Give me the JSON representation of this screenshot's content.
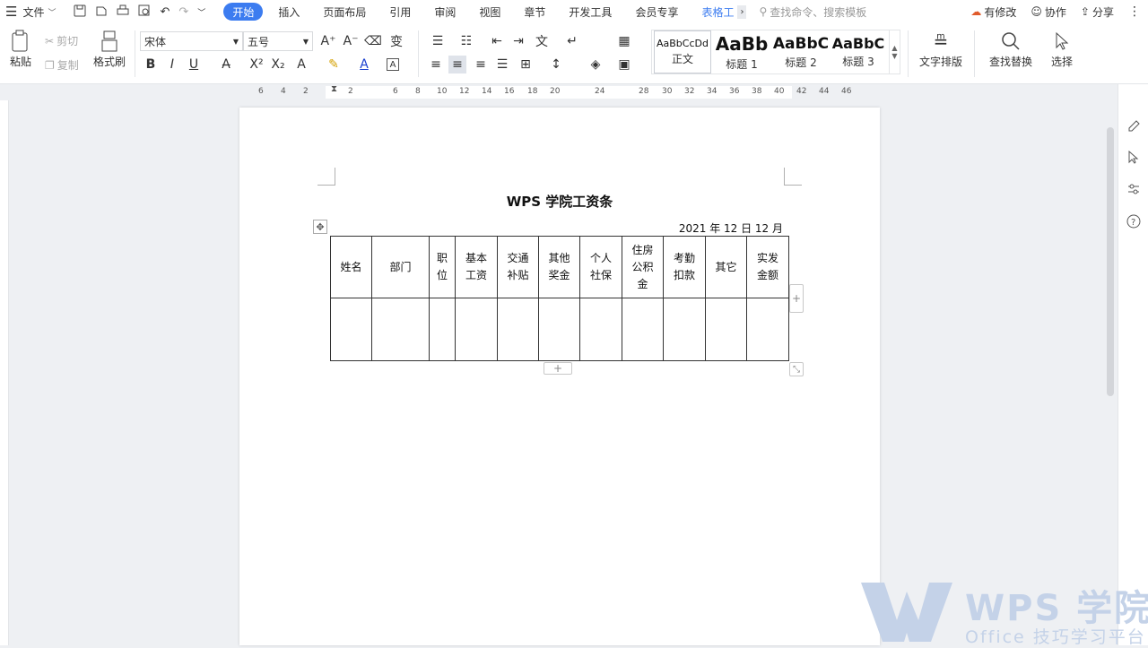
{
  "menubar": {
    "file_label": "文件",
    "tabs": [
      {
        "label": "开始",
        "active": true
      },
      {
        "label": "插入"
      },
      {
        "label": "页面布局"
      },
      {
        "label": "引用"
      },
      {
        "label": "审阅"
      },
      {
        "label": "视图"
      },
      {
        "label": "章节"
      },
      {
        "label": "开发工具"
      },
      {
        "label": "会员专享"
      },
      {
        "label": "表格工"
      }
    ],
    "search_placeholder": "查找命令、搜索模板",
    "actions": {
      "changes": "有修改",
      "collab": "协作",
      "share": "分享"
    }
  },
  "ribbon": {
    "paste": "粘贴",
    "cut": "剪切",
    "copy": "复制",
    "format_painter": "格式刷",
    "font_name": "宋体",
    "font_size": "五号",
    "styles": [
      {
        "sample": "AaBbCcDd",
        "name": "正文"
      },
      {
        "sample": "AaBb",
        "name": "标题 1"
      },
      {
        "sample": "AaBbC",
        "name": "标题 2"
      },
      {
        "sample": "AaBbC",
        "name": "标题 3"
      }
    ],
    "text_layout": "文字排版",
    "find_replace": "查找替换",
    "select": "选择"
  },
  "ruler": {
    "ticks": [
      "6",
      "4",
      "2",
      "2",
      "6",
      "8",
      "10",
      "12",
      "14",
      "16",
      "18",
      "20",
      "24",
      "28",
      "30",
      "32",
      "34",
      "36",
      "38",
      "40",
      "42",
      "44",
      "46"
    ]
  },
  "document": {
    "title": "WPS 学院工资条",
    "date": "2021 年 12 日 12 月",
    "headers": [
      "姓名",
      "部门",
      "职\n位",
      "基本\n工资",
      "交通\n补贴",
      "其他\n奖金",
      "个人\n社保",
      "住房\n公积\n金",
      "考勤\n扣款",
      "其它",
      "实发\n金额"
    ]
  },
  "watermark": {
    "brand": "WPS 学院",
    "subtitle": "Office 技巧学习平台"
  },
  "colors": {
    "accent": "#3c7cf0",
    "watermark": "#c4d2e8"
  }
}
